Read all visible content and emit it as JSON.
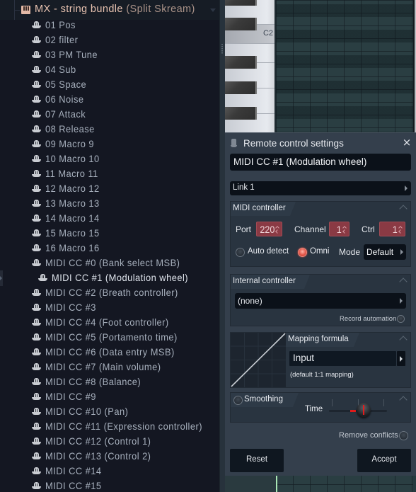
{
  "browser": {
    "plugin": {
      "name": "MX - string bundle",
      "subtitle": "(Split Skream)"
    },
    "items": [
      {
        "label": "01 Pos"
      },
      {
        "label": "02 filter"
      },
      {
        "label": "03 PM Tune"
      },
      {
        "label": "04 Sub"
      },
      {
        "label": "05 Space"
      },
      {
        "label": "06 Noise"
      },
      {
        "label": "07 Attack"
      },
      {
        "label": "08 Release"
      },
      {
        "label": "09 Macro 9"
      },
      {
        "label": "10 Macro 10"
      },
      {
        "label": "11 Macro 11"
      },
      {
        "label": "12 Macro 12"
      },
      {
        "label": "13 Macro 13"
      },
      {
        "label": "14 Macro 14"
      },
      {
        "label": "15 Macro 15"
      },
      {
        "label": "16 Macro 16"
      },
      {
        "label": "MIDI CC #0 (Bank select MSB)"
      },
      {
        "label": "MIDI CC #1 (Modulation wheel)",
        "selected": true
      },
      {
        "label": "MIDI CC #2 (Breath controller)"
      },
      {
        "label": "MIDI CC #3"
      },
      {
        "label": "MIDI CC #4 (Foot controller)"
      },
      {
        "label": "MIDI CC #5 (Portamento time)"
      },
      {
        "label": "MIDI CC #6 (Data entry MSB)"
      },
      {
        "label": "MIDI CC #7 (Main volume)"
      },
      {
        "label": "MIDI CC #8 (Balance)"
      },
      {
        "label": "MIDI CC #9"
      },
      {
        "label": "MIDI CC #10 (Pan)"
      },
      {
        "label": "MIDI CC #11 (Expression controller)"
      },
      {
        "label": "MIDI CC #12 (Control 1)"
      },
      {
        "label": "MIDI CC #13 (Control 2)"
      },
      {
        "label": "MIDI CC #14"
      },
      {
        "label": "MIDI CC #15"
      }
    ]
  },
  "pianoroll": {
    "key_label": "C2"
  },
  "dialog": {
    "title": "Remote control settings",
    "close_icon": "×",
    "target_name": "MIDI CC #1 (Modulation wheel)",
    "link": "Link 1",
    "midi_controller": {
      "section_label": "MIDI controller",
      "port_label": "Port",
      "port_value": "220",
      "channel_label": "Channel",
      "channel_value": "1",
      "ctrl_label": "Ctrl",
      "ctrl_value": "1",
      "auto_detect_label": "Auto detect",
      "auto_detect_on": false,
      "omni_label": "Omni",
      "omni_on": true,
      "mode_label": "Mode",
      "mode_value": "Default"
    },
    "internal_controller": {
      "section_label": "Internal controller",
      "value": "(none)",
      "record_automation_label": "Record automation",
      "record_automation_on": false
    },
    "mapping_formula": {
      "section_label": "Mapping formula",
      "value": "Input",
      "description": "(default 1:1 mapping)"
    },
    "smoothing": {
      "section_label": "Smoothing",
      "enabled": false,
      "time_label": "Time",
      "time_value_fraction": 0.6
    },
    "remove_conflicts_label": "Remove conflicts",
    "remove_conflicts_on": false,
    "reset_label": "Reset",
    "accept_label": "Accept"
  },
  "colors": {
    "accent_red": "#e21b1b",
    "spin_bg": "#8a3a44",
    "plugin_title": "#e7c2b0",
    "dialog_bg": "#343f4c"
  }
}
